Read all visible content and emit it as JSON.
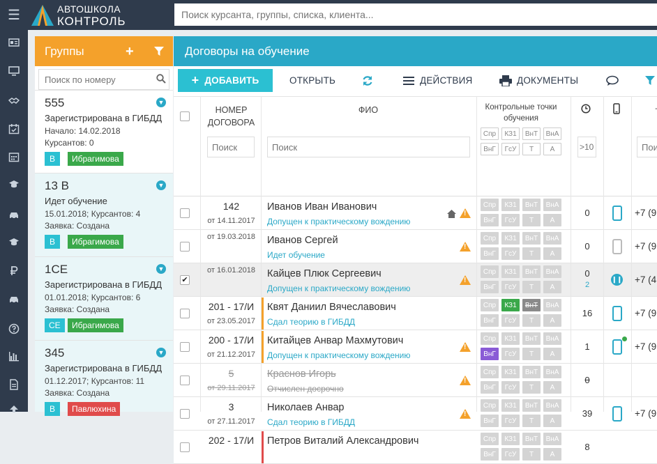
{
  "app": {
    "logo_line1": "АВТОШКОЛА",
    "logo_line2": "КОНТРОЛЬ",
    "search_placeholder": "Поиск курсанта, группы, списка, клиента..."
  },
  "nav_icons": [
    "id-card-icon",
    "monitor-icon",
    "handshake-icon",
    "calendar-check-icon",
    "calendar-icon",
    "graduation-cap-icon",
    "car-icon",
    "graduation-cap-icon",
    "ruble-icon",
    "car-icon",
    "help-icon",
    "bar-chart-icon",
    "document-icon",
    "upload-icon"
  ],
  "groups": {
    "title": "Группы",
    "search_placeholder": "Поиск по номеру",
    "items": [
      {
        "number": "555",
        "status": "Зарегистрирована в ГИБДД",
        "line1": "Начало: 14.02.2018",
        "line2": "Курсантов: 0",
        "category": "B",
        "instructor": "Ибрагимова",
        "instructor_color": "#3aa84a"
      },
      {
        "number": "13 B",
        "status": "Идет обучение",
        "line1": "15.01.2018; Курсантов: 4",
        "line2": "Заявка: Создана",
        "category": "B",
        "instructor": "Ибрагимова",
        "instructor_color": "#3aa84a"
      },
      {
        "number": "1CE",
        "status": "Зарегистрирована в ГИБДД",
        "line1": "01.01.2018; Курсантов: 6",
        "line2": "Заявка: Создана",
        "category": "CE",
        "instructor": "Ибрагимова",
        "instructor_color": "#3aa84a"
      },
      {
        "number": "345",
        "status": "Зарегистрирована в ГИБДД",
        "line1": "01.12.2017; Курсантов: 11",
        "line2": "Заявка: Создана",
        "category": "B",
        "instructor": "Павлюхина",
        "instructor_color": "#e04b4b"
      }
    ]
  },
  "main": {
    "title": "Договоры на обучение",
    "toolbar": {
      "add": "ДОБАВИТЬ",
      "open": "ОТКРЫТЬ",
      "actions": "ДЕЙСТВИЯ",
      "documents": "ДОКУМЕНТЫ"
    },
    "columns": {
      "number": "НОМЕР ДОГОВОРА",
      "fio": "ФИО",
      "checkpoints": "Контрольные точки обучения",
      "search_ph": "Поиск",
      "count_ph": ">10",
      "phone_ph": "Пои"
    },
    "checkpoint_labels": [
      "Спр",
      "КЗ1",
      "ВнТ",
      "ВнА",
      "ВнГ",
      "ГсУ",
      "Т",
      "А"
    ],
    "rows": [
      {
        "num": "142",
        "date": "от 14.11.2017",
        "fio": "Иванов Иван Иванович",
        "status": "Допущен к практическому вождению",
        "count": "0",
        "extra": "",
        "phone": "+7 (9",
        "checked": false,
        "struck": false,
        "home": true,
        "warn": true,
        "bar": "",
        "phone_icon": "blue",
        "cps": [
          "g",
          "g",
          "g",
          "g",
          "g",
          "g",
          "g",
          "g"
        ]
      },
      {
        "num": "",
        "date": "от 19.03.2018",
        "fio": "Иванов Сергей",
        "status": "Идет обучение",
        "count": "0",
        "extra": "",
        "phone": "+7 (9",
        "checked": false,
        "struck": false,
        "home": false,
        "warn": true,
        "bar": "",
        "phone_icon": "grey",
        "cps": [
          "g",
          "g",
          "g",
          "g",
          "g",
          "g",
          "g",
          "g"
        ]
      },
      {
        "num": "",
        "date": "от 16.01.2018",
        "fio": "Кайцев Плюк Сергеевич",
        "status": "Допущен к практическому вождению",
        "count": "0",
        "extra": "2",
        "phone": "+7 (4",
        "checked": true,
        "struck": false,
        "home": false,
        "warn": true,
        "bar": "",
        "phone_icon": "pause",
        "cps": [
          "g",
          "g",
          "g",
          "g",
          "g",
          "g",
          "g",
          "g"
        ]
      },
      {
        "num": "201 - 17/И",
        "date": "от 23.05.2017",
        "fio": "Квят Даниил Вячеславович",
        "status": "Сдал теорию в ГИБДД",
        "count": "16",
        "extra": "",
        "phone": "+7 (9",
        "checked": false,
        "struck": false,
        "home": false,
        "warn": false,
        "bar": "#f4a12b",
        "phone_icon": "blue",
        "cps": [
          "g",
          "gr",
          "dk",
          "g",
          "g",
          "g",
          "g",
          "g"
        ]
      },
      {
        "num": "200 - 17/И",
        "date": "от 21.12.2017",
        "fio": "Китайцев Анвар Махмутович",
        "status": "Допущен к практическому вождению",
        "count": "1",
        "extra": "",
        "phone": "+7 (9",
        "checked": false,
        "struck": false,
        "home": false,
        "warn": true,
        "bar": "#f4a12b",
        "phone_icon": "blue-dot",
        "cps": [
          "g",
          "g",
          "g",
          "g",
          "pu",
          "g",
          "g",
          "g"
        ]
      },
      {
        "num": "5",
        "date": "от 29.11.2017",
        "fio": "Краснов Игорь",
        "status": "Отчислен досрочно",
        "count": "0",
        "extra": "",
        "phone": "",
        "checked": false,
        "struck": true,
        "home": false,
        "warn": true,
        "bar": "",
        "phone_icon": "",
        "cps": [
          "g",
          "g",
          "g",
          "g",
          "g",
          "g",
          "g",
          "g"
        ]
      },
      {
        "num": "3",
        "date": "от 27.11.2017",
        "fio": "Николаев Анвар",
        "status": "Сдал теорию в ГИБДД",
        "count": "39",
        "extra": "",
        "phone": "+7 (9",
        "checked": false,
        "struck": false,
        "home": false,
        "warn": true,
        "bar": "",
        "phone_icon": "blue",
        "cps": [
          "g",
          "g",
          "g",
          "g",
          "g",
          "g",
          "g",
          "g"
        ]
      },
      {
        "num": "202 - 17/И",
        "date": "",
        "fio": "Петров Виталий Александрович",
        "status": "",
        "count": "8",
        "extra": "",
        "phone": "",
        "checked": false,
        "struck": false,
        "home": false,
        "warn": false,
        "bar": "#e04b4b",
        "phone_icon": "",
        "cps": [
          "g",
          "g",
          "g",
          "g",
          "g",
          "g",
          "g",
          "g"
        ]
      }
    ]
  }
}
